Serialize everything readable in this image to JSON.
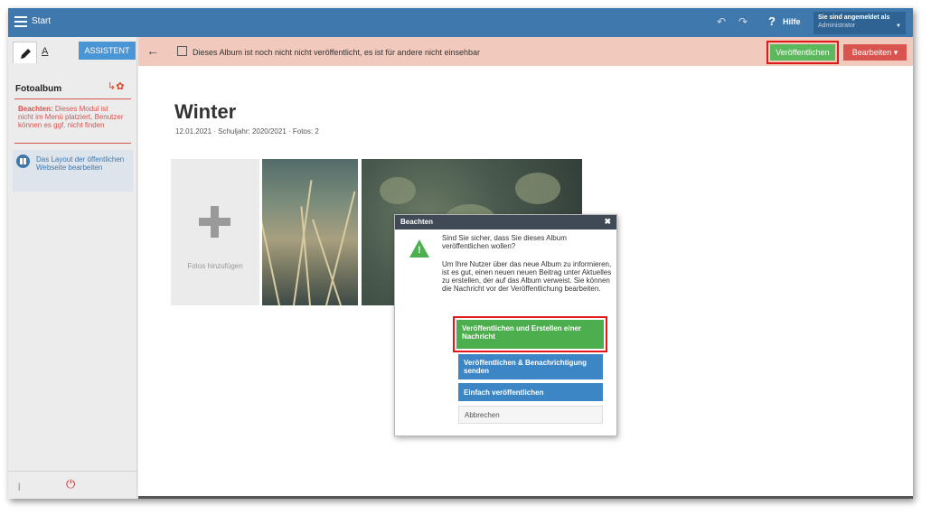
{
  "topbar": {
    "start_label": "Start",
    "help_label": "Hilfe",
    "login_title": "Sie sind angemeldet als",
    "login_user": "Administrator"
  },
  "sidebar": {
    "a_tab": "A",
    "assistant_label": "ASSISTENT",
    "module_title": "Fotoalbum",
    "warning_bold": "Beachten:",
    "warning_text": "Dieses Modul ist nicht im Menü platziert, Benutzer können es ggf. nicht finden",
    "layout_link": "Das Layout der öffentlichen Webseite bearbeiten"
  },
  "notice": {
    "text": "Dieses Album ist noch nicht nicht veröffentlicht, es ist für andere nicht einsehbar",
    "publish_label": "Veröffentlichen",
    "edit_label": "Bearbeiten ▾"
  },
  "album": {
    "title": "Winter",
    "meta": "12.01.2021 · Schuljahr: 2020/2021 · Fotos: 2",
    "add_photos_label": "Fotos hinzufügen"
  },
  "dialog": {
    "title": "Beachten",
    "close": "✖",
    "question": "Sind Sie sicher, dass Sie dieses Album veröffentlichen wollen?",
    "info": "Um Ihre Nutzer über das neue Album zu informieren, ist es gut, einen neuen neuen Beitrag unter Aktuelles zu erstellen, der auf das Album verweist. Sie können die Nachricht vor der Veröffentlichung bearbeiten.",
    "btn_publish_news": "Veröffentlichen und Erstellen einer Nachricht",
    "btn_publish_notify": "Veröffentlichen & Benachrichtigung senden",
    "btn_publish_simple": "Einfach veröffentlichen",
    "btn_cancel": "Abbrechen"
  },
  "colors": {
    "topbar": "#3e78ad",
    "notice_bg": "#f2c9bd",
    "green": "#5cb85c",
    "red": "#d9534f",
    "blue_btn": "#3c86c6",
    "highlight": "#e01818"
  },
  "icons": [
    "menu-icon",
    "undo-icon",
    "redo-icon",
    "pencil-icon",
    "gear-icon",
    "layout-icon",
    "power-icon",
    "back-arrow-icon",
    "edit-note-icon",
    "plus-icon",
    "warning-icon",
    "close-icon"
  ]
}
